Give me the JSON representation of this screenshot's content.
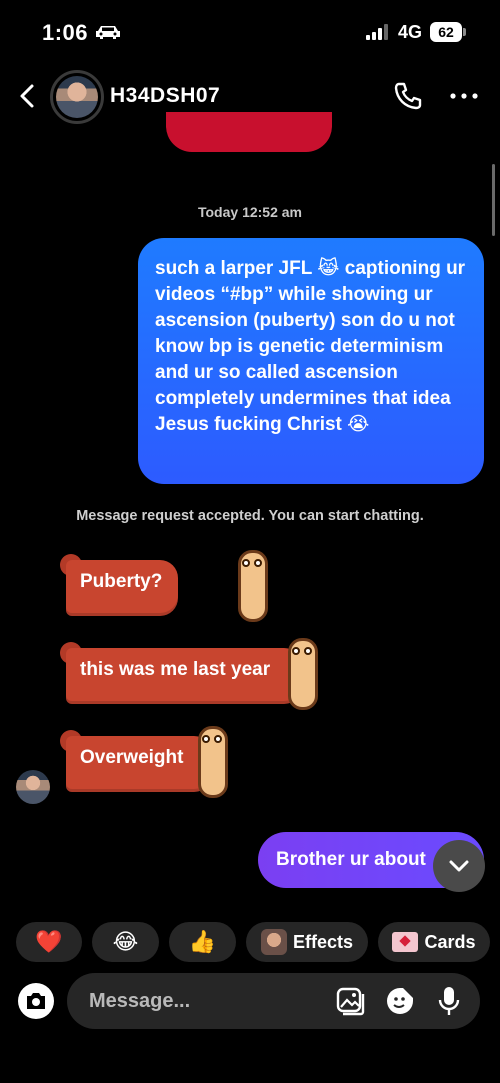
{
  "status": {
    "time": "1:06",
    "network": "4G",
    "battery": "62"
  },
  "header": {
    "contact_name": "H34DSH07"
  },
  "chat": {
    "timestamp": "Today 12:52 am",
    "sent_message": "such a larper JFL 😹 captioning ur videos “#bp” while showing ur ascension (puberty) son do u not know bp is genetic determinism and ur so called ascension completely undermines that idea Jesus fucking Christ 😭",
    "system_note": "Message request accepted. You can start chatting.",
    "sticker_1": "Puberty?",
    "sticker_2": "this was me last year",
    "sticker_3": "Overweight",
    "sent_message_2": "Brother ur about"
  },
  "quick_reactions": {
    "heart": "❤️",
    "laugh": "😂",
    "thumbs": "👍",
    "effects_label": "Effects",
    "cards_label": "Cards"
  },
  "composer": {
    "placeholder": "Message..."
  }
}
